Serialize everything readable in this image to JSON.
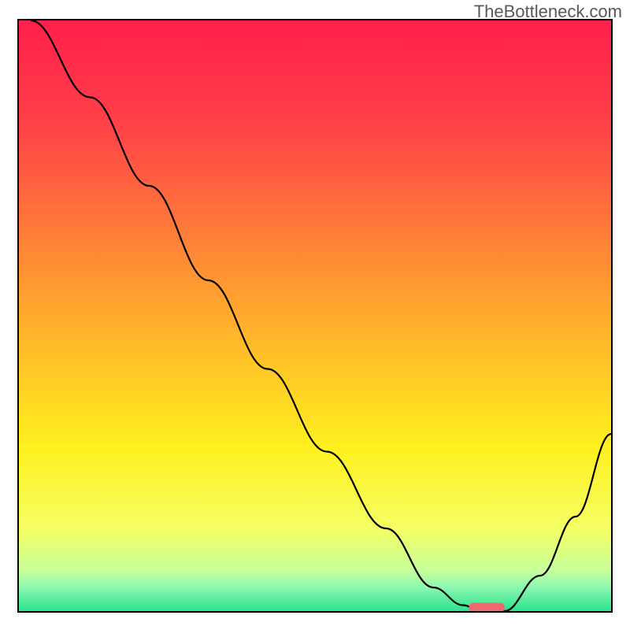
{
  "watermark": "TheBottleneck.com",
  "chart_data": {
    "type": "line",
    "title": "",
    "xlabel": "",
    "ylabel": "",
    "xlim": [
      0,
      100
    ],
    "ylim": [
      0,
      100
    ],
    "grid": false,
    "gradient_stops": [
      {
        "offset": 0,
        "color": "#ff1f4b"
      },
      {
        "offset": 18,
        "color": "#ff4248"
      },
      {
        "offset": 40,
        "color": "#ff8a34"
      },
      {
        "offset": 58,
        "color": "#ffc427"
      },
      {
        "offset": 72,
        "color": "#fff01e"
      },
      {
        "offset": 86,
        "color": "#f4ff63"
      },
      {
        "offset": 93,
        "color": "#c8ff9a"
      },
      {
        "offset": 96,
        "color": "#8cf7b0"
      },
      {
        "offset": 100,
        "color": "#2be28d"
      }
    ],
    "series": [
      {
        "name": "curve",
        "x": [
          2,
          12,
          22,
          32,
          42,
          52,
          62,
          70,
          75,
          78,
          82,
          88,
          94,
          100
        ],
        "values": [
          100,
          87,
          72,
          56,
          41,
          27,
          14,
          4,
          1,
          0,
          0,
          6,
          16,
          30
        ]
      }
    ],
    "marker": {
      "x_start": 76,
      "x_end": 82,
      "y": 0.6
    }
  }
}
